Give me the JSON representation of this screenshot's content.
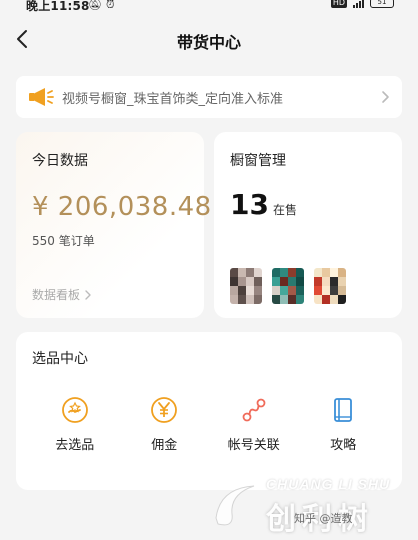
{
  "status_bar": {
    "time": "晚上11:58",
    "network_badge": "HD",
    "battery_level": "51",
    "icons": [
      "mute-icon",
      "alarm-icon",
      "hd-icon",
      "signal-icon",
      "battery-icon"
    ]
  },
  "nav": {
    "back_icon": "chevron-left-icon",
    "title": "带货中心"
  },
  "notice": {
    "icon": "megaphone-icon",
    "text": "视频号橱窗_珠宝首饰类_定向准入标准",
    "arrow_icon": "chevron-right-icon"
  },
  "today": {
    "title": "今日数据",
    "amount": "¥ 206,038.48",
    "orders": "550 笔订单",
    "dashboard_label": "数据看板"
  },
  "window": {
    "title": "橱窗管理",
    "count": "13",
    "count_label": "在售",
    "thumbnails": [
      "product-thumbnail-1",
      "product-thumbnail-2",
      "product-thumbnail-3"
    ]
  },
  "picks": {
    "title": "选品中心",
    "items": [
      {
        "label": "去选品",
        "icon": "select-product-icon"
      },
      {
        "label": "佣金",
        "icon": "yen-coin-icon"
      },
      {
        "label": "帐号关联",
        "icon": "link-accounts-icon"
      },
      {
        "label": "攻略",
        "icon": "guide-book-icon"
      }
    ]
  },
  "watermark": {
    "en": "CHUANG LI SHU",
    "cn": "创利树",
    "small": "知乎 @造教"
  },
  "colors": {
    "accent_gold": "#b3905a",
    "icon_orange": "#f0a020",
    "icon_coral": "#f06b5a",
    "icon_blue": "#3a8fd8",
    "background": "#f4f4f4"
  }
}
